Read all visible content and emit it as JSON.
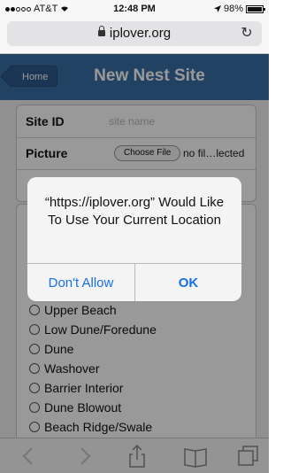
{
  "status_bar": {
    "carrier": "AT&T",
    "time": "12:48 PM",
    "battery": "98%",
    "battery_level": 0.98
  },
  "browser": {
    "url": "iplover.org"
  },
  "app": {
    "home_label": "Home",
    "title": "New Nest Site"
  },
  "form": {
    "site_id_label": "Site ID",
    "site_id_placeholder": "site name",
    "picture_label": "Picture",
    "choose_file_label": "Choose File",
    "file_status": "no fil…lected"
  },
  "options": [
    "Upper Beach",
    "Low Dune/Foredune",
    "Dune",
    "Washover",
    "Barrier Interior",
    "Dune Blowout",
    "Beach Ridge/Swale"
  ],
  "alert": {
    "message": "“https://iplover.org” Would Like To Use Your Current Location",
    "deny_label": "Don't Allow",
    "ok_label": "OK"
  },
  "toolbar": {
    "icons": [
      "back-icon",
      "forward-icon",
      "share-icon",
      "bookmarks-icon",
      "tabs-icon"
    ]
  },
  "colors": {
    "header_blue": "#3a6fa6",
    "alert_button_blue": "#1670e6"
  }
}
